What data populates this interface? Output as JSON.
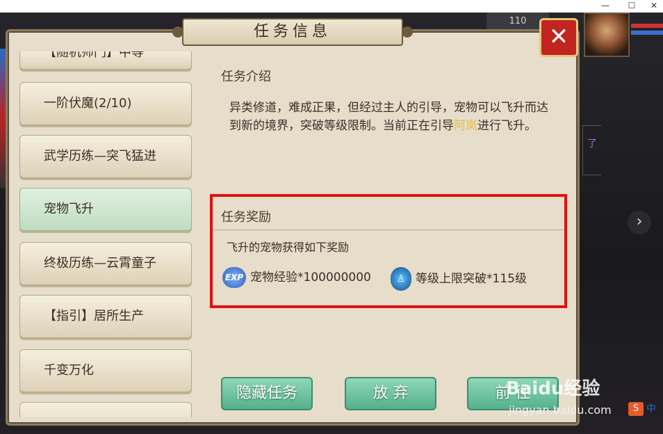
{
  "window": {
    "controls": [
      "—",
      "☐",
      "✕"
    ]
  },
  "hud": {
    "topright_text": "110"
  },
  "side_text": "了",
  "dialog": {
    "title": "任务信息",
    "close_label": "✕"
  },
  "task_list": [
    {
      "label": "【随机师门】中等"
    },
    {
      "label": "一阶伏魔(2/10)"
    },
    {
      "label": "武学历练—突飞猛进"
    },
    {
      "label": "宠物飞升"
    },
    {
      "label": "终极历练—云霄童子"
    },
    {
      "label": "【指引】居所生产"
    },
    {
      "label": "千变万化"
    }
  ],
  "intro": {
    "title": "任务介绍",
    "text_before": "异类修道，难成正果，但经过主人的引导，宠物可以飞升而达到新的境界，突破等级限制。当前正在引导",
    "pet_name": "阿岚",
    "text_after": "进行飞升。"
  },
  "reward": {
    "title": "任务奖励",
    "subtitle": "飞升的宠物获得如下奖励",
    "items": [
      {
        "icon": "EXP",
        "label": "宠物经验*100000000"
      },
      {
        "icon": "level-break-icon",
        "label": "等级上限突破*115级"
      }
    ]
  },
  "buttons": {
    "hide": "隐藏任务",
    "abandon": "放 弃",
    "goto": "前 往"
  },
  "watermark": {
    "brand": "Baidu经验",
    "url": "jingyan.baidu.com"
  },
  "ime": {
    "badge": "S",
    "text": "中"
  }
}
